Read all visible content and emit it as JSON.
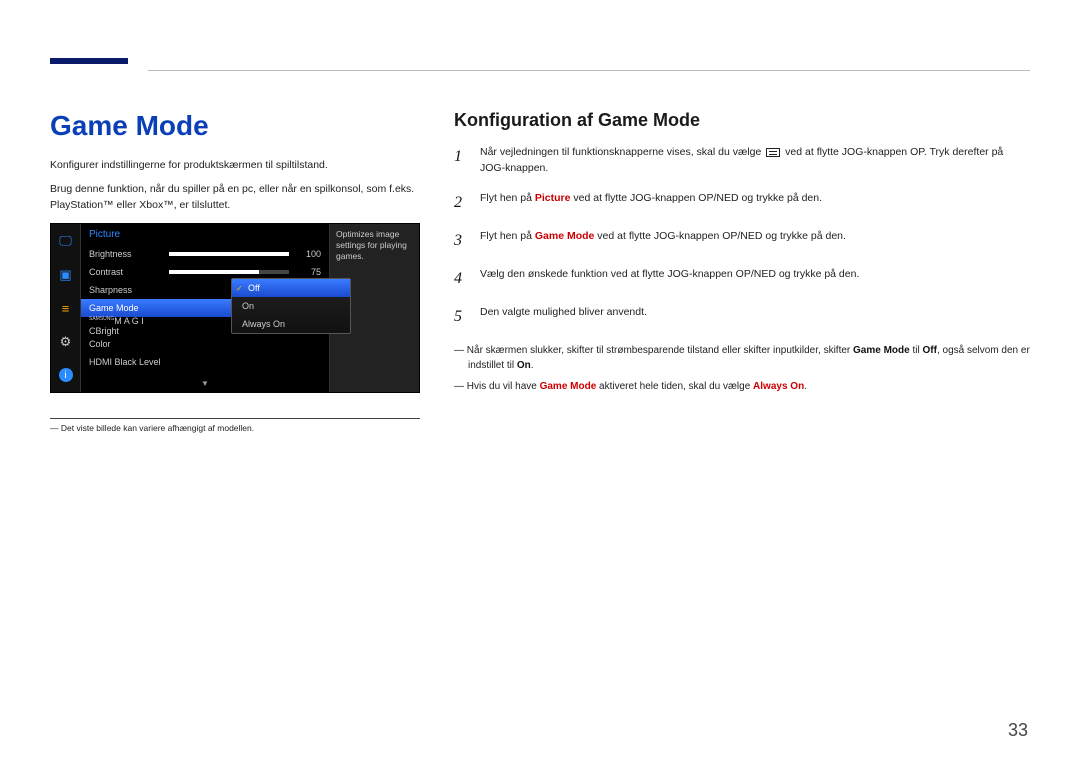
{
  "page_number": "33",
  "left": {
    "title": "Game Mode",
    "p1": "Konfigurer indstillingerne for produktskærmen til spiltilstand.",
    "p2": "Brug denne funktion, når du spiller på en pc, eller når en spilkonsol, som f.eks. PlayStation™ eller Xbox™, er tilsluttet.",
    "footnote": "Det viste billede kan variere afhængigt af modellen."
  },
  "osd": {
    "header": "Picture",
    "help": "Optimizes image settings for playing games.",
    "items": [
      {
        "label": "Brightness",
        "type": "slider",
        "fill": 100,
        "value": "100"
      },
      {
        "label": "Contrast",
        "type": "slider",
        "fill": 75,
        "value": "75"
      },
      {
        "label": "Sharpness",
        "type": "text"
      },
      {
        "label": "Game Mode",
        "type": "text",
        "highlight": true
      },
      {
        "label": "M A G I C",
        "sup": "SAMSUNG",
        "suffix": "Bright",
        "type": "text"
      },
      {
        "label": "Color",
        "type": "text"
      },
      {
        "label": "HDMI Black Level",
        "type": "text"
      }
    ],
    "submenu": [
      {
        "label": "Off",
        "selected": true
      },
      {
        "label": "On"
      },
      {
        "label": "Always On"
      }
    ],
    "arrow": "▼"
  },
  "right": {
    "title": "Konfiguration af Game Mode",
    "steps": [
      {
        "n": "1",
        "pre": "Når vejledningen til funktionsknapperne vises, skal du vælge ",
        "icon": true,
        "post": " ved at flytte JOG-knappen OP. Tryk derefter på JOG-knappen."
      },
      {
        "n": "2",
        "pre": "Flyt hen på ",
        "red": "Picture",
        "post": " ved at flytte JOG-knappen OP/NED og trykke på den."
      },
      {
        "n": "3",
        "pre": "Flyt hen på ",
        "red": "Game Mode",
        "post": " ved at flytte JOG-knappen OP/NED og trykke på den."
      },
      {
        "n": "4",
        "text": "Vælg den ønskede funktion ved at flytte JOG-knappen OP/NED og trykke på den."
      },
      {
        "n": "5",
        "text": "Den valgte mulighed bliver anvendt."
      }
    ],
    "notes": [
      {
        "parts": [
          {
            "t": "Når skærmen slukker, skifter til strømbesparende tilstand eller skifter inputkilder, skifter "
          },
          {
            "b": "Game Mode"
          },
          {
            "t": " til "
          },
          {
            "b": "Off"
          },
          {
            "t": ", også selvom den er indstillet til "
          },
          {
            "b": "On"
          },
          {
            "t": "."
          }
        ]
      },
      {
        "parts": [
          {
            "t": "Hvis du vil have "
          },
          {
            "r": "Game Mode"
          },
          {
            "t": " aktiveret hele tiden, skal du vælge "
          },
          {
            "r": "Always On"
          },
          {
            "t": "."
          }
        ]
      }
    ]
  }
}
